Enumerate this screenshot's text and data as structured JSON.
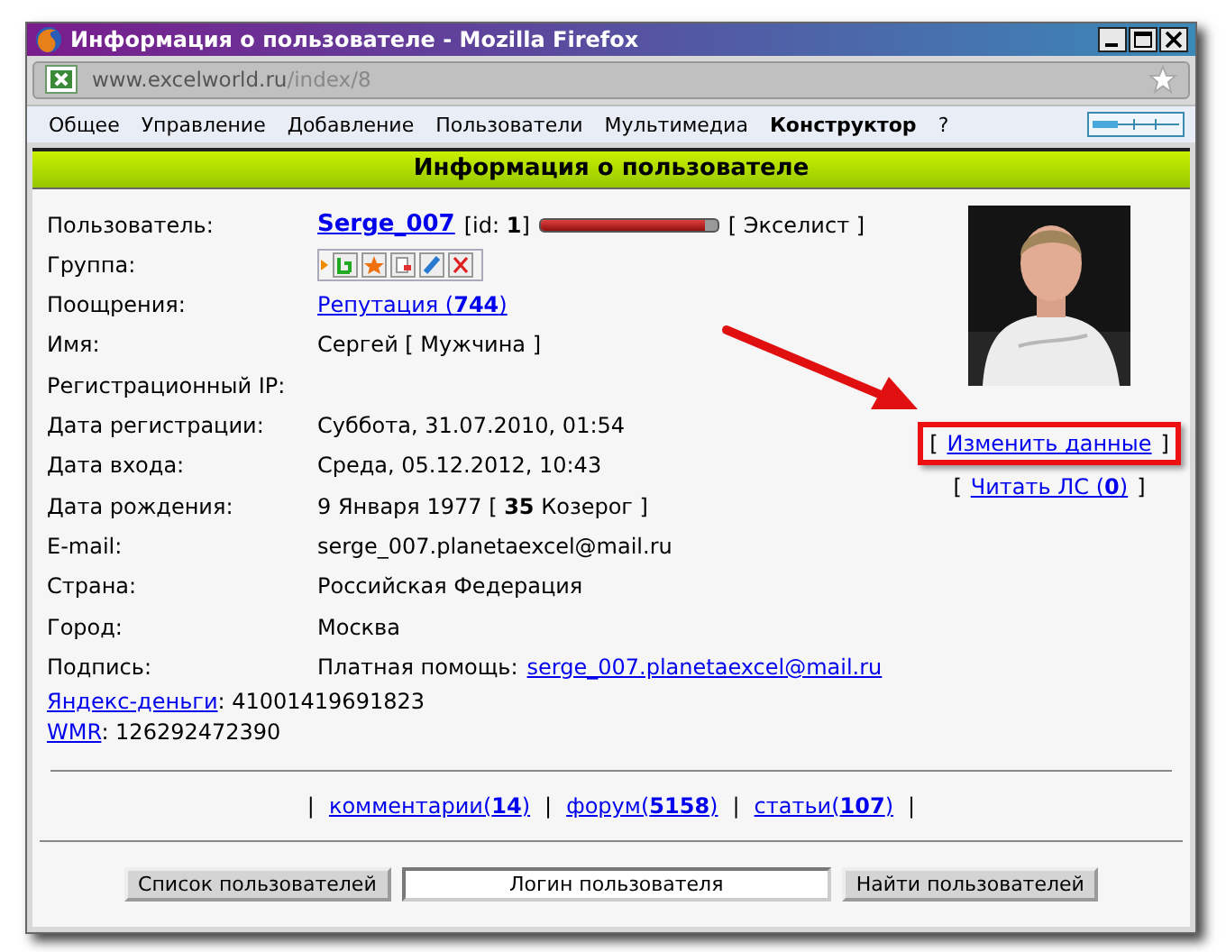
{
  "window": {
    "title": "Информация о пользователе - Mozilla Firefox"
  },
  "address_bar": {
    "host": "www.excelworld.ru",
    "path": "/index/8"
  },
  "menu": [
    {
      "label": "Общее",
      "selected": false
    },
    {
      "label": "Управление",
      "selected": false
    },
    {
      "label": "Добавление",
      "selected": false
    },
    {
      "label": "Пользователи",
      "selected": false
    },
    {
      "label": "Мультимедиа",
      "selected": false
    },
    {
      "label": "Конструктор",
      "selected": true
    },
    {
      "label": "?",
      "selected": false
    }
  ],
  "header": "Информация о пользователе",
  "fields": [
    {
      "label": "Пользователь:",
      "kind": "user",
      "name": "Serge_007",
      "id": "[id: **1**]",
      "level": 0.93,
      "rank": "[ Экселист ]"
    },
    {
      "label": "Группа:",
      "kind": "icons"
    },
    {
      "label": "Поощрения:",
      "kind": "link",
      "value": "Репутация (**744**)"
    },
    {
      "label": "Имя:",
      "kind": "text",
      "value": "Сергей [ Мужчина ]"
    },
    {
      "label": "Регистрационный IP:",
      "kind": "text"
    },
    {
      "label": "Дата регистрации:",
      "kind": "text",
      "value": "Суббота, 31.07.2010, 01:54"
    },
    {
      "label": "Дата входа:",
      "kind": "text",
      "value": "Среда, 05.12.2012, 10:43"
    },
    {
      "label": "Дата рождения:",
      "kind": "text",
      "value": "9 Января 1977 [ **35** Козерог ]"
    },
    {
      "label": "E-mail:",
      "kind": "text",
      "value": "serge_007.planetaexcel@mail.ru"
    },
    {
      "label": "Страна:",
      "kind": "text",
      "value": "Российская Федерация"
    },
    {
      "label": "Город:",
      "kind": "text",
      "value": "Москва"
    },
    {
      "label": "Подпись:",
      "kind": "signature",
      "value": "Платная помощь:",
      "link": "serge_007.planetaexcel@mail.ru"
    }
  ],
  "payments": [
    {
      "link": "Яндекс-деньги",
      "value": ": 41001419691823"
    },
    {
      "link": "WMR",
      "value": ": 126292472390"
    }
  ],
  "actions": [
    {
      "open": "[",
      "link": "Изменить данные",
      "close": "]",
      "highlighted": true
    },
    {
      "open": "[",
      "link": "Читать ЛС (**0**)",
      "close": "]",
      "highlighted": false
    }
  ],
  "stats": [
    {
      "kind": "separator",
      "text": "|"
    },
    {
      "kind": "link",
      "text": "комментарии(**14**)"
    },
    {
      "kind": "separator",
      "text": "|"
    },
    {
      "kind": "link",
      "text": "форум(**5158**)"
    },
    {
      "kind": "separator",
      "text": "|"
    },
    {
      "kind": "link",
      "text": "статьи(**107**)"
    },
    {
      "kind": "separator",
      "text": "|"
    }
  ],
  "search": {
    "list_button": "Список пользователей",
    "placeholder": "Логин пользователя",
    "find_button": "Найти пользователей"
  }
}
